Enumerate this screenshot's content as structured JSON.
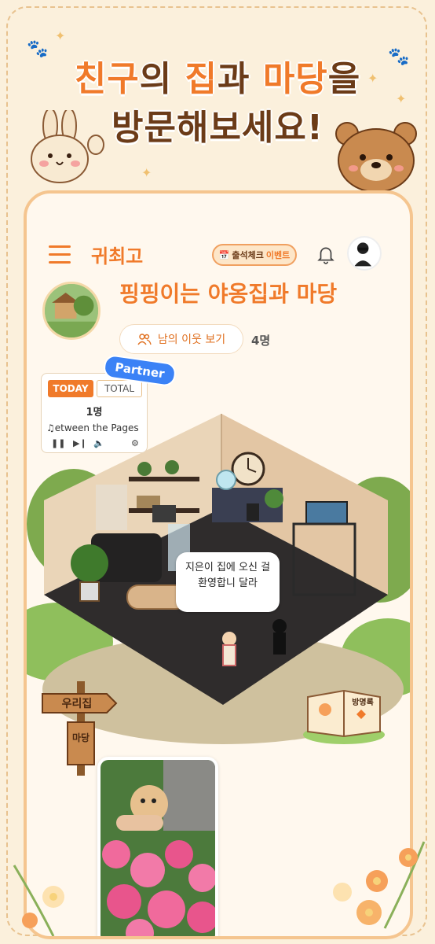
{
  "headline": {
    "line1_a": "친구",
    "line1_b": "의 ",
    "line1_c": "집",
    "line1_d": "과 ",
    "line1_e": "마당",
    "line1_f": "을",
    "line2": "방문해보세요!"
  },
  "appbar": {
    "logo": "귀최고",
    "attendance_label": "출석체크",
    "attendance_event": "이벤트"
  },
  "house": {
    "title": "핑핑이는 야옹집과 마당",
    "neighbor_button": "남의 이웃 보기",
    "neighbor_count": "4명"
  },
  "visitor": {
    "today_tab": "TODAY",
    "total_tab": "TOTAL",
    "count": "1명",
    "song": "♫etween the Pages"
  },
  "partner_badge": "Partner",
  "speech_bubble": "지은이 집에 오신 걸 환영합니 달라",
  "sign": {
    "top": "우리집",
    "bottom": "마당"
  },
  "guestbook_label": "방명록",
  "colors": {
    "accent": "#f07a2a",
    "background": "#fbf0dc",
    "partner": "#3b82f6"
  },
  "icons": [
    "menu-icon",
    "bell-icon",
    "users-icon",
    "pause-icon",
    "next-icon",
    "volume-icon",
    "settings-icon"
  ]
}
